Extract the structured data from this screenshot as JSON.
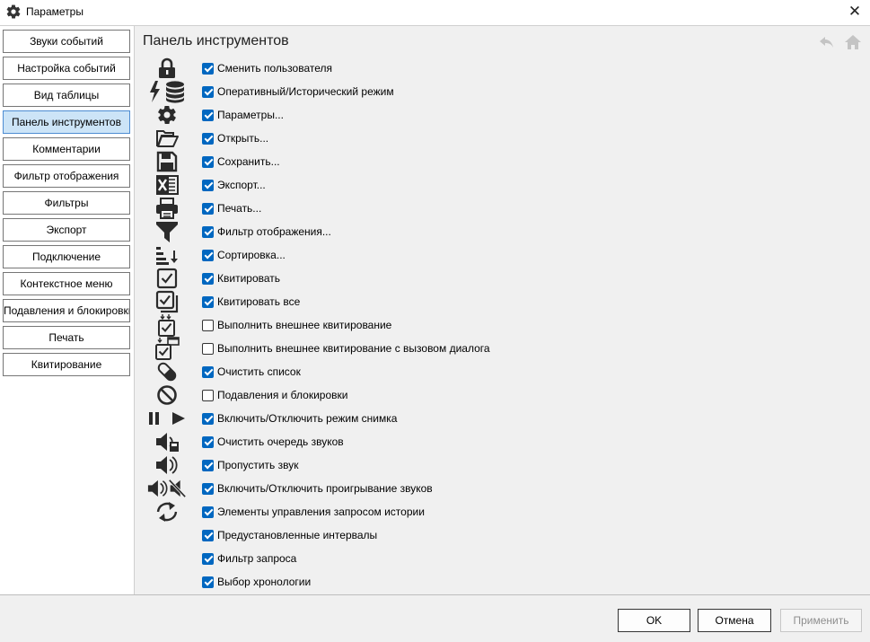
{
  "window": {
    "title": "Параметры",
    "app_icon": "gear-icon",
    "close_icon": "close-icon"
  },
  "sidebar": {
    "items": [
      {
        "label": "Звуки событий",
        "active": false
      },
      {
        "label": "Настройка событий",
        "active": false
      },
      {
        "label": "Вид таблицы",
        "active": false
      },
      {
        "label": "Панель инструментов",
        "active": true
      },
      {
        "label": "Комментарии",
        "active": false
      },
      {
        "label": "Фильтр отображения",
        "active": false
      },
      {
        "label": "Фильтры",
        "active": false
      },
      {
        "label": "Экспорт",
        "active": false
      },
      {
        "label": "Подключение",
        "active": false
      },
      {
        "label": "Контекстное меню",
        "active": false
      },
      {
        "label": "Подавления и блокировки",
        "active": false
      },
      {
        "label": "Печать",
        "active": false
      },
      {
        "label": "Квитирование",
        "active": false
      }
    ]
  },
  "main": {
    "heading": "Панель инструментов",
    "back_icon": "undo-arrow-icon",
    "home_icon": "home-icon",
    "tools": [
      {
        "label": "Сменить пользователя",
        "checked": true,
        "icon": "lock-icon"
      },
      {
        "label": "Оперативный/Исторический режим",
        "checked": true,
        "icon": "lightning-database-icon"
      },
      {
        "label": "Параметры...",
        "checked": true,
        "icon": "gear-icon"
      },
      {
        "label": "Открыть...",
        "checked": true,
        "icon": "folder-open-icon"
      },
      {
        "label": "Сохранить...",
        "checked": true,
        "icon": "floppy-disk-icon"
      },
      {
        "label": "Экспорт...",
        "checked": true,
        "icon": "excel-icon"
      },
      {
        "label": "Печать...",
        "checked": true,
        "icon": "printer-icon"
      },
      {
        "label": "Фильтр отображения...",
        "checked": true,
        "icon": "funnel-icon"
      },
      {
        "label": "Сортировка...",
        "checked": true,
        "icon": "sort-icon"
      },
      {
        "label": "Квитировать",
        "checked": true,
        "icon": "checkbox-icon"
      },
      {
        "label": "Квитировать все",
        "checked": true,
        "icon": "checkbox-all-icon"
      },
      {
        "label": "Выполнить внешнее квитирование",
        "checked": false,
        "icon": "external-acknowledge-icon"
      },
      {
        "label": "Выполнить внешнее квитирование с вызовом диалога",
        "checked": false,
        "icon": "external-acknowledge-dialog-icon"
      },
      {
        "label": "Очистить список",
        "checked": true,
        "icon": "eraser-icon"
      },
      {
        "label": "Подавления и блокировки",
        "checked": false,
        "icon": "prohibited-icon"
      },
      {
        "label": "Включить/Отключить режим снимка",
        "checked": true,
        "icon": "pause-play-icon"
      },
      {
        "label": "Очистить очередь звуков",
        "checked": true,
        "icon": "speaker-clear-icon"
      },
      {
        "label": "Пропустить звук",
        "checked": true,
        "icon": "speaker-skip-icon"
      },
      {
        "label": "Включить/Отключить проигрывание звуков",
        "checked": true,
        "icon": "speaker-mute-icon"
      },
      {
        "label": "Элементы управления запросом истории",
        "checked": true,
        "icon": "history-arrows-icon"
      },
      {
        "label": "Предустановленные интервалы",
        "checked": true,
        "icon": ""
      },
      {
        "label": "Фильтр запроса",
        "checked": true,
        "icon": ""
      },
      {
        "label": "Выбор хронологии",
        "checked": true,
        "icon": ""
      }
    ]
  },
  "footer": {
    "ok_label": "OK",
    "cancel_label": "Отмена",
    "apply_label": "Применить"
  },
  "colors": {
    "accent": "#0067c0",
    "active_item_bg": "#cce4f7",
    "content_bg": "#f0f0f0"
  }
}
